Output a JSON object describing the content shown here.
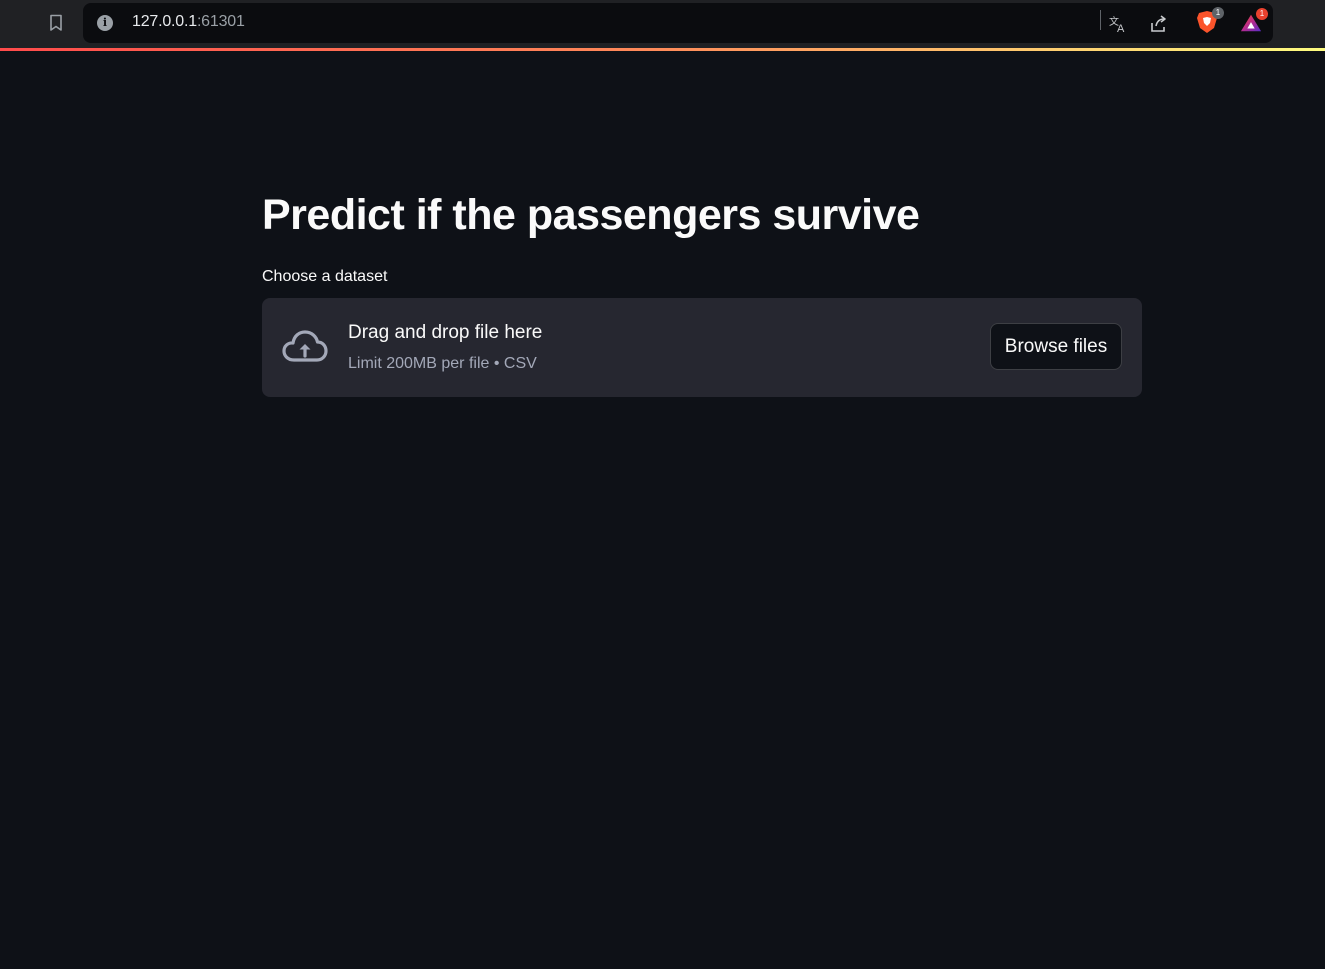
{
  "browser": {
    "url_host": "127.0.0.1",
    "url_port": ":61301",
    "brave_badge": "1",
    "rewards_badge": "1"
  },
  "main": {
    "title": "Predict if the passengers survive",
    "uploader": {
      "label": "Choose a dataset",
      "dropzone_title": "Drag and drop file here",
      "dropzone_subtitle": "Limit 200MB per file • CSV",
      "browse_label": "Browse files"
    }
  },
  "colors": {
    "background": "#0e1117",
    "dropzone": "#262730",
    "text": "#fafafa",
    "muted_text": "#a3a8b8",
    "accent_gradient_start": "#ff4b4b",
    "accent_gradient_end": "#fffd80"
  }
}
